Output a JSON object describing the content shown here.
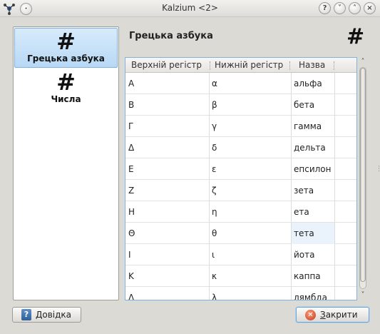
{
  "window": {
    "title": "Kalzium <2>",
    "controls": [
      "?",
      "˅",
      "˄",
      "×"
    ]
  },
  "sidebar": {
    "items": [
      {
        "icon": "#",
        "label": "Грецька азбука",
        "selected": true
      },
      {
        "icon": "#",
        "label": "Числа",
        "selected": false
      }
    ]
  },
  "page": {
    "title": "Грецька азбука",
    "icon": "#"
  },
  "table": {
    "headers": [
      "Верхній регістр",
      "Нижній регістр",
      "Назва"
    ],
    "rows": [
      [
        "Α",
        "α",
        "альфа"
      ],
      [
        "Β",
        "β",
        "бета"
      ],
      [
        "Γ",
        "γ",
        "гамма"
      ],
      [
        "Δ",
        "δ",
        "дельта"
      ],
      [
        "Ε",
        "ε",
        "епсилон"
      ],
      [
        "Ζ",
        "ζ",
        "зета"
      ],
      [
        "Η",
        "η",
        "ета"
      ],
      [
        "Θ",
        "θ",
        "тета"
      ],
      [
        "Ι",
        "ι",
        "йота"
      ],
      [
        "Κ",
        "κ",
        "каппа"
      ],
      [
        "Λ",
        "λ",
        "лямбда"
      ]
    ],
    "highlighted_row": 7
  },
  "buttons": {
    "help_label": "Довідка",
    "close_label_first": "З",
    "close_label_rest": "акрити"
  }
}
